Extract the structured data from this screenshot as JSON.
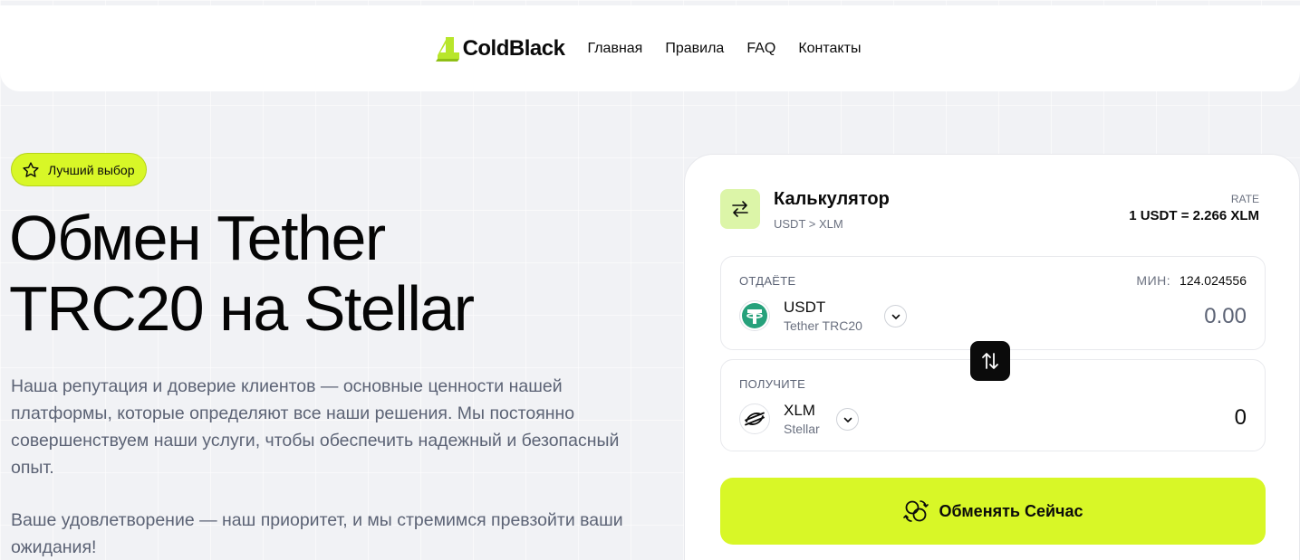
{
  "header": {
    "logo_text": "ColdBlack",
    "nav": [
      "Главная",
      "Правила",
      "FAQ",
      "Контакты"
    ]
  },
  "hero": {
    "badge": "Лучший выбор",
    "title_line1": "Обмен Tether",
    "title_line2": "TRC20 на Stellar",
    "paragraph1": "Наша репутация и доверие клиентов — основные ценности нашей платформы, которые определяют все наши решения. Мы постоянно совершенствуем наши услуги, чтобы обеспечить надежный и безопасный опыт.",
    "paragraph2": "Ваше удовлетворение — наш приоритет, и мы стремимся превзойти ваши ожидания!"
  },
  "calculator": {
    "title": "Калькулятор",
    "pair": "USDT > XLM",
    "rate_label": "RATE",
    "rate_value": "1 USDT = 2.266 XLM",
    "give": {
      "label": "ОТДАЁТЕ",
      "coin": "USDT",
      "network": "Tether TRC20",
      "min_label": "МИН:",
      "min_value": "124.024556",
      "amount": "0.00"
    },
    "get": {
      "label": "ПОЛУЧИТЕ",
      "coin": "XLM",
      "network": "Stellar",
      "amount": "0"
    },
    "exchange_button": "Обменять Сейчас"
  },
  "colors": {
    "accent": "#d8f727",
    "tether": "#26a17b",
    "text_muted": "#5c6375"
  },
  "icons": {
    "logo": "coldblack-logo-icon",
    "badge": "star-icon",
    "calculator": "arrows-left-right-icon",
    "give_coin": "tether-icon",
    "get_coin": "stellar-icon",
    "swap": "arrows-up-down-icon",
    "exchange": "coins-exchange-icon"
  }
}
